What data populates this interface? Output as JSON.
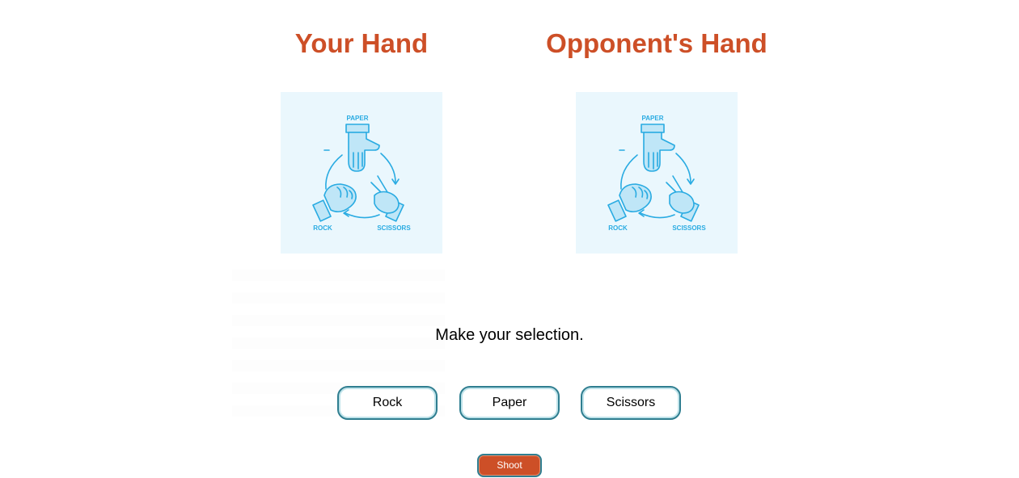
{
  "player": {
    "title": "Your Hand",
    "image_labels": {
      "paper": "PAPER",
      "rock": "ROCK",
      "scissors": "SCISSORS"
    }
  },
  "opponent": {
    "title": "Opponent's Hand",
    "image_labels": {
      "paper": "PAPER",
      "rock": "ROCK",
      "scissors": "SCISSORS"
    }
  },
  "message": "Make your selection.",
  "choices": [
    "Rock",
    "Paper",
    "Scissors"
  ],
  "shoot_label": "Shoot",
  "colors": {
    "title": "#cd4f27",
    "shoot_bg": "#cd4f27",
    "button_border": "#2f7e90",
    "illustration": "#29abe2",
    "illustration_bg": "#eaf7fd"
  },
  "icons": {
    "player_image": "rock-paper-scissors-diagram-icon",
    "opponent_image": "rock-paper-scissors-diagram-icon"
  }
}
